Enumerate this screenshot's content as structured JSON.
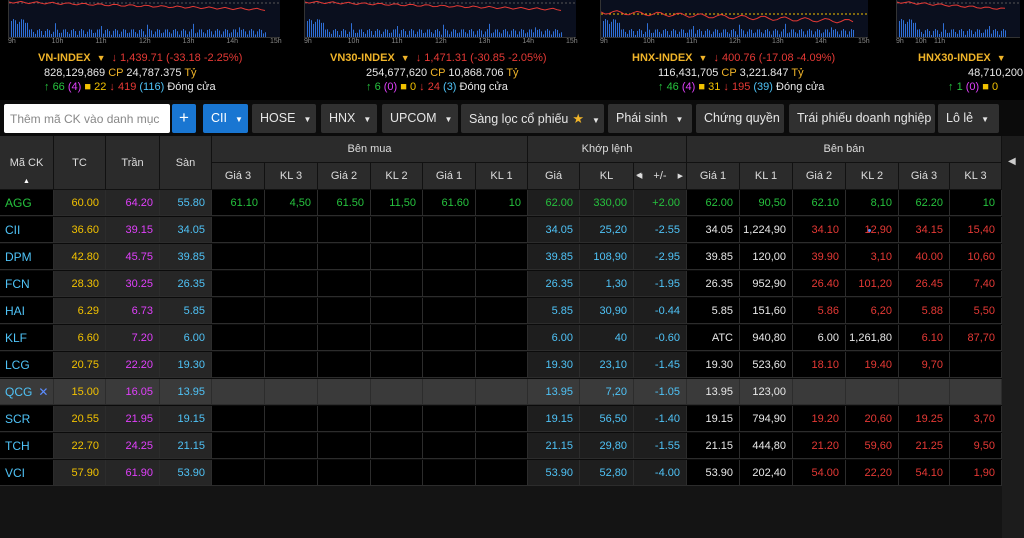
{
  "indexes": [
    {
      "name": "VN-INDEX",
      "value": "1,439.71",
      "change": "(-33.18 -2.25%)",
      "volume": "828,129,869",
      "cp_label": "CP",
      "turnover": "24,787.375",
      "unit": "Tỷ",
      "up": "66",
      "ceiling": "(4)",
      "flat": "22",
      "down": "419",
      "floor": "(116)",
      "status": "Đóng cửa",
      "hours": [
        "9h",
        "10h",
        "11h",
        "12h",
        "13h",
        "14h",
        "15h"
      ]
    },
    {
      "name": "VN30-INDEX",
      "value": "1,471.31",
      "change": "(-30.85 -2.05%)",
      "volume": "254,677,620",
      "cp_label": "CP",
      "turnover": "10,868.706",
      "unit": "Tỷ",
      "up": "6",
      "ceiling": "(0)",
      "flat": "0",
      "down": "24",
      "floor": "(3)",
      "status": "Đóng cửa",
      "hours": [
        "9h",
        "10h",
        "11h",
        "12h",
        "13h",
        "14h",
        "15h"
      ]
    },
    {
      "name": "HNX-INDEX",
      "value": "400.76",
      "change": "(-17.08 -4.09%)",
      "volume": "116,431,705",
      "cp_label": "CP",
      "turnover": "3,221.847",
      "unit": "Tỷ",
      "up": "46",
      "ceiling": "(4)",
      "flat": "31",
      "down": "195",
      "floor": "(39)",
      "status": "Đóng cửa",
      "hours": [
        "9h",
        "10h",
        "11h",
        "12h",
        "13h",
        "14h",
        "15h"
      ]
    },
    {
      "name": "HNX30-INDEX",
      "volume": "48,710,200",
      "up": "1",
      "ceiling": "(0)",
      "flat": "0",
      "hours": [
        "9h",
        "10h",
        "11h"
      ]
    }
  ],
  "toolbar": {
    "search_placeholder": "Thêm mã CK vào danh mục",
    "plus": "+",
    "buttons": [
      "CII",
      "HOSE",
      "HNX",
      "UPCOM",
      "Sàng lọc cổ phiếu",
      "Phái sinh",
      "Chứng quyền",
      "Trái phiếu doanh nghiệp",
      "Lô lẻ"
    ]
  },
  "table": {
    "headers": {
      "symbol": "Mã CK",
      "ref": "TC",
      "ceil": "Trần",
      "floor": "Sàn",
      "buy_group": "Bên mua",
      "match_group": "Khớp lệnh",
      "sell_group": "Bên bán",
      "buy": [
        "Giá 3",
        "KL 3",
        "Giá 2",
        "KL 2",
        "Giá 1",
        "KL 1"
      ],
      "match": [
        "Giá",
        "KL",
        "+/-"
      ],
      "sell": [
        "Giá 1",
        "KL 1",
        "Giá 2",
        "KL 2",
        "Giá 3",
        "KL 3"
      ]
    },
    "rows": [
      {
        "sym": "AGG",
        "tc": "60.00",
        "ceil": "64.20",
        "floor": "55.80",
        "b3": "61.10",
        "bk3": "4,50",
        "b2": "61.50",
        "bk2": "11,50",
        "b1": "61.60",
        "bk1": "10",
        "mp": "62.00",
        "mkl": "330,00",
        "chg": "+2.00",
        "s1": "62.00",
        "sk1": "90,50",
        "s2": "62.10",
        "sk2": "8,10",
        "s3": "62.20",
        "sk3": "10",
        "tone": "up"
      },
      {
        "sym": "CII",
        "tc": "36.60",
        "ceil": "39.15",
        "floor": "34.05",
        "b3": "",
        "bk3": "",
        "b2": "",
        "bk2": "",
        "b1": "",
        "bk1": "",
        "mp": "34.05",
        "mkl": "25,20",
        "chg": "-2.55",
        "s1": "34.05",
        "sk1": "1,224,90",
        "s2": "34.10",
        "sk2": "12,90",
        "s3": "34.15",
        "sk3": "15,40",
        "tone": "floor"
      },
      {
        "sym": "DPM",
        "tc": "42.80",
        "ceil": "45.75",
        "floor": "39.85",
        "b3": "",
        "bk3": "",
        "b2": "",
        "bk2": "",
        "b1": "",
        "bk1": "",
        "mp": "39.85",
        "mkl": "108,90",
        "chg": "-2.95",
        "s1": "39.85",
        "sk1": "120,00",
        "s2": "39.90",
        "sk2": "3,10",
        "s3": "40.00",
        "sk3": "10,60",
        "tone": "floor"
      },
      {
        "sym": "FCN",
        "tc": "28.30",
        "ceil": "30.25",
        "floor": "26.35",
        "b3": "",
        "bk3": "",
        "b2": "",
        "bk2": "",
        "b1": "",
        "bk1": "",
        "mp": "26.35",
        "mkl": "1,30",
        "chg": "-1.95",
        "s1": "26.35",
        "sk1": "952,90",
        "s2": "26.40",
        "sk2": "101,20",
        "s3": "26.45",
        "sk3": "7,40",
        "tone": "floor"
      },
      {
        "sym": "HAI",
        "tc": "6.29",
        "ceil": "6.73",
        "floor": "5.85",
        "b3": "",
        "bk3": "",
        "b2": "",
        "bk2": "",
        "b1": "",
        "bk1": "",
        "mp": "5.85",
        "mkl": "30,90",
        "chg": "-0.44",
        "s1": "5.85",
        "sk1": "151,60",
        "s2": "5.86",
        "sk2": "6,20",
        "s3": "5.88",
        "sk3": "5,50",
        "tone": "floor"
      },
      {
        "sym": "KLF",
        "tc": "6.60",
        "ceil": "7.20",
        "floor": "6.00",
        "b3": "",
        "bk3": "",
        "b2": "",
        "bk2": "",
        "b1": "",
        "bk1": "",
        "mp": "6.00",
        "mkl": "40",
        "chg": "-0.60",
        "s1": "ATC",
        "sk1": "940,80",
        "s2": "6.00",
        "sk2": "1,261,80",
        "s3": "6.10",
        "sk3": "87,70",
        "tone": "floor"
      },
      {
        "sym": "LCG",
        "tc": "20.75",
        "ceil": "22.20",
        "floor": "19.30",
        "b3": "",
        "bk3": "",
        "b2": "",
        "bk2": "",
        "b1": "",
        "bk1": "",
        "mp": "19.30",
        "mkl": "23,10",
        "chg": "-1.45",
        "s1": "19.30",
        "sk1": "523,60",
        "s2": "18.10",
        "sk2": "19.40",
        "s3": "9,70",
        "sk3": "",
        "tone": "floor",
        "lcg": true
      },
      {
        "sym": "QCG",
        "tc": "15.00",
        "ceil": "16.05",
        "floor": "13.95",
        "b3": "",
        "bk3": "",
        "b2": "",
        "bk2": "",
        "b1": "",
        "bk1": "",
        "mp": "13.95",
        "mkl": "7,20",
        "chg": "-1.05",
        "s1": "13.95",
        "sk1": "123,00",
        "s2": "",
        "sk2": "",
        "s3": "",
        "sk3": "",
        "tone": "floor",
        "highlight": true
      },
      {
        "sym": "SCR",
        "tc": "20.55",
        "ceil": "21.95",
        "floor": "19.15",
        "b3": "",
        "bk3": "",
        "b2": "",
        "bk2": "",
        "b1": "",
        "bk1": "",
        "mp": "19.15",
        "mkl": "56,50",
        "chg": "-1.40",
        "s1": "19.15",
        "sk1": "794,90",
        "s2": "19.20",
        "sk2": "20,60",
        "s3": "19.25",
        "sk3": "3,70",
        "tone": "floor"
      },
      {
        "sym": "TCH",
        "tc": "22.70",
        "ceil": "24.25",
        "floor": "21.15",
        "b3": "",
        "bk3": "",
        "b2": "",
        "bk2": "",
        "b1": "",
        "bk1": "",
        "mp": "21.15",
        "mkl": "29,80",
        "chg": "-1.55",
        "s1": "21.15",
        "sk1": "444,80",
        "s2": "21.20",
        "sk2": "59,60",
        "s3": "21.25",
        "sk3": "9,50",
        "tone": "floor"
      },
      {
        "sym": "VCI",
        "tc": "57.90",
        "ceil": "61.90",
        "floor": "53.90",
        "b3": "",
        "bk3": "",
        "b2": "",
        "bk2": "",
        "b1": "",
        "bk1": "",
        "mp": "53.90",
        "mkl": "52,80",
        "chg": "-4.00",
        "s1": "53.90",
        "sk1": "202,40",
        "s2": "54.00",
        "sk2": "22,20",
        "s3": "54.10",
        "sk3": "1,90",
        "tone": "floor"
      }
    ]
  },
  "colors": {
    "up": "#26c23e",
    "down": "#e53935",
    "floor": "#4fc3f7",
    "ceiling": "#e040fb",
    "ref": "#f2c200",
    "accent": "#1976d2"
  }
}
